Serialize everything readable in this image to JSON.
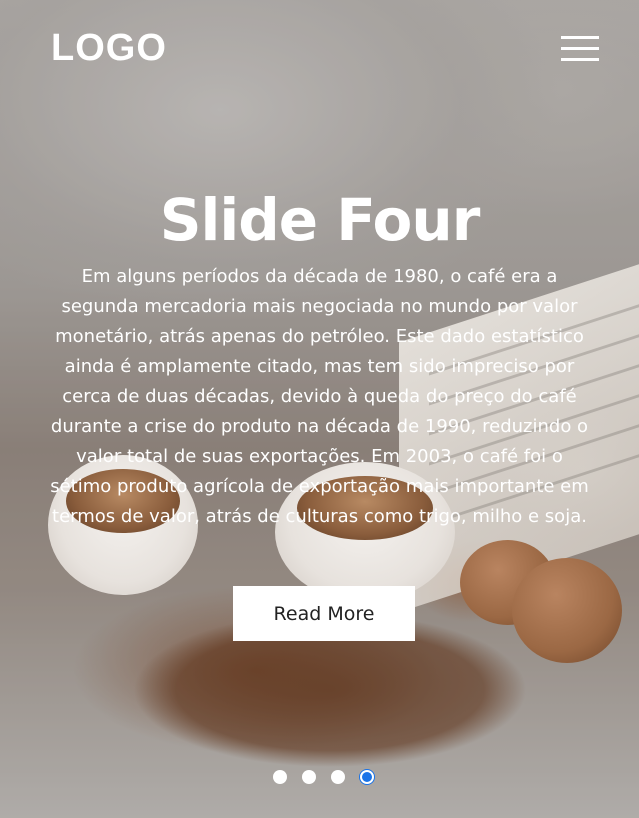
{
  "header": {
    "logo": "LOGO",
    "menu_icon": "hamburger-menu-icon"
  },
  "slide": {
    "title": "Slide Four",
    "text": "Em alguns períodos da década de 1980, o café era a segunda mercadoria mais negociada no mundo por valor monetário, atrás apenas do petróleo. Este dado estatístico ainda é amplamente citado, mas tem sido impreciso por cerca de duas décadas, devido à queda do preço do café durante a crise do produto na década de 1990, reduzindo o valor total de suas exportações. Em 2003, o café foi o sétimo produto agrícola de exportação mais importante em termos de valor, atrás de culturas como trigo, milho e soja.",
    "button_label": "Read More"
  },
  "carousel": {
    "slide_count": 4,
    "active_index": 3
  },
  "colors": {
    "accent": "#1a73e8",
    "text": "#ffffff",
    "button_bg": "#ffffff",
    "button_text": "#222222"
  }
}
